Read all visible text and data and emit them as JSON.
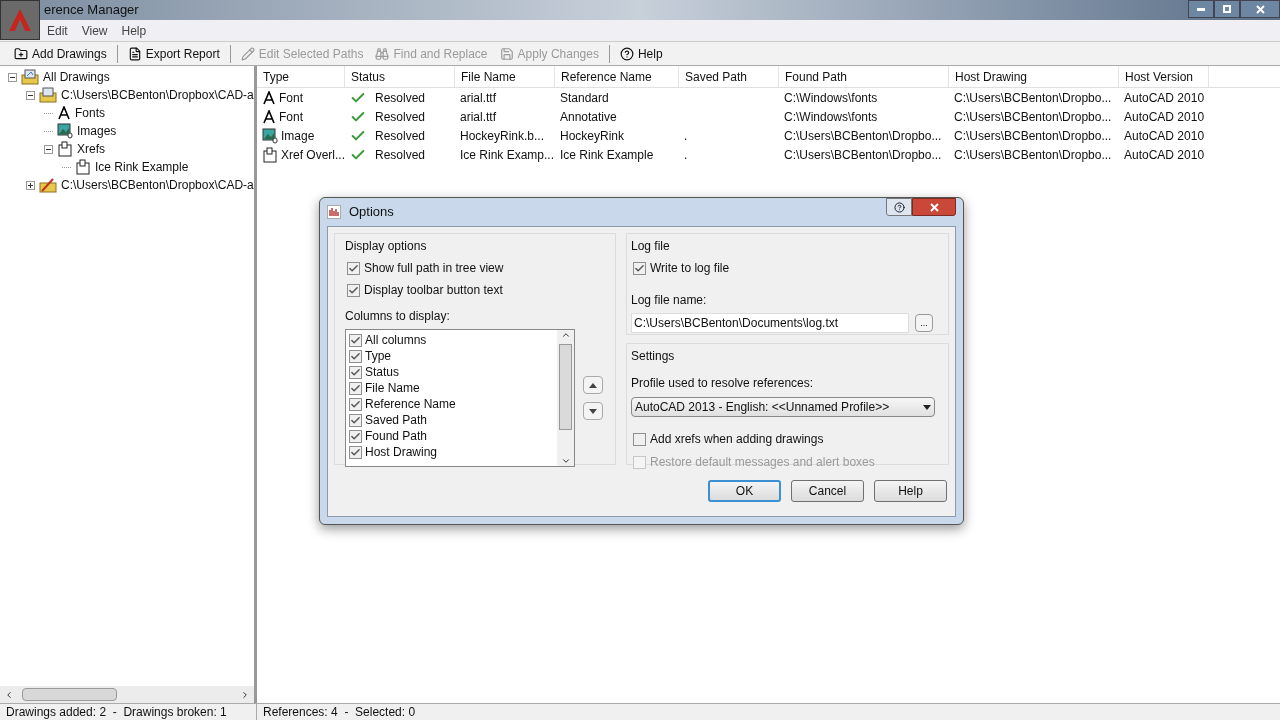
{
  "window": {
    "title": "erence Manager"
  },
  "menu": [
    "Edit",
    "View",
    "Help"
  ],
  "toolbar": [
    {
      "label": "Add Drawings",
      "disabled": false
    },
    {
      "label": "Export Report",
      "disabled": false
    },
    {
      "label": "Edit Selected Paths",
      "disabled": true
    },
    {
      "label": "Find and Replace",
      "disabled": true
    },
    {
      "label": "Apply Changes",
      "disabled": true
    },
    {
      "label": "Help",
      "disabled": false
    }
  ],
  "tree": [
    {
      "label": "All Drawings",
      "kind": "all",
      "expanded": true,
      "children": [
        {
          "label": "C:\\Users\\BCBenton\\Dropbox\\CAD-a",
          "kind": "drawing",
          "expanded": true,
          "children": [
            {
              "label": "Fonts",
              "kind": "font"
            },
            {
              "label": "Images",
              "kind": "image"
            },
            {
              "label": "Xrefs",
              "kind": "xref",
              "expanded": true,
              "children": [
                {
                  "label": "Ice Rink Example",
                  "kind": "xref"
                }
              ]
            }
          ]
        },
        {
          "label": "C:\\Users\\BCBenton\\Dropbox\\CAD-a",
          "kind": "broken",
          "expanded": false
        }
      ]
    }
  ],
  "table": {
    "columns": [
      "Type",
      "Status",
      "File Name",
      "Reference Name",
      "Saved Path",
      "Found Path",
      "Host Drawing",
      "Host Version"
    ],
    "rows": [
      {
        "kind": "font",
        "cells": [
          "Font",
          "Resolved",
          "arial.ttf",
          "Standard",
          "",
          "C:\\Windows\\fonts",
          "C:\\Users\\BCBenton\\Dropbo...",
          "AutoCAD 2010"
        ]
      },
      {
        "kind": "font",
        "cells": [
          "Font",
          "Resolved",
          "arial.ttf",
          "Annotative",
          "",
          "C:\\Windows\\fonts",
          "C:\\Users\\BCBenton\\Dropbo...",
          "AutoCAD 2010"
        ]
      },
      {
        "kind": "image",
        "cells": [
          "Image",
          "Resolved",
          "HockeyRink.b...",
          "HockeyRink",
          ".",
          "C:\\Users\\BCBenton\\Dropbo...",
          "C:\\Users\\BCBenton\\Dropbo...",
          "AutoCAD 2010"
        ]
      },
      {
        "kind": "xref",
        "cells": [
          "Xref Overl...",
          "Resolved",
          "Ice Rink Examp...",
          "Ice Rink Example",
          ".",
          "C:\\Users\\BCBenton\\Dropbo...",
          "C:\\Users\\BCBenton\\Dropbo...",
          "AutoCAD 2010"
        ]
      }
    ]
  },
  "status_bar": [
    "Drawings added: 2  -  Drawings broken: 1",
    "References: 4  -  Selected: 0"
  ],
  "dialog": {
    "title": "Options",
    "display_options": {
      "heading": "Display options",
      "checks": [
        {
          "label": "Show full path in tree view",
          "checked": true
        },
        {
          "label": "Display toolbar button text",
          "checked": true
        }
      ],
      "columns_label": "Columns to display:",
      "columns": [
        {
          "label": "All columns",
          "checked": true
        },
        {
          "label": "Type",
          "checked": true
        },
        {
          "label": "Status",
          "checked": true
        },
        {
          "label": "File Name",
          "checked": true
        },
        {
          "label": "Reference Name",
          "checked": true
        },
        {
          "label": "Saved Path",
          "checked": true
        },
        {
          "label": "Found Path",
          "checked": true
        },
        {
          "label": "Host Drawing",
          "checked": true
        }
      ]
    },
    "log_file": {
      "heading": "Log file",
      "check": {
        "label": "Write to log file",
        "checked": true
      },
      "name_label": "Log file name:",
      "value": "C:\\Users\\BCBenton\\Documents\\log.txt",
      "browse": "..."
    },
    "settings": {
      "heading": "Settings",
      "profile_label": "Profile used to resolve references:",
      "profile": "AutoCAD 2013 - English: <<Unnamed Profile>>",
      "checks": [
        {
          "label": "Add xrefs when adding drawings",
          "checked": false,
          "disabled": false
        },
        {
          "label": "Restore default messages and alert boxes",
          "checked": false,
          "disabled": true
        }
      ]
    },
    "buttons": [
      {
        "label": "OK",
        "selected": true
      },
      {
        "label": "Cancel",
        "selected": false
      },
      {
        "label": "Help",
        "selected": false
      }
    ]
  }
}
